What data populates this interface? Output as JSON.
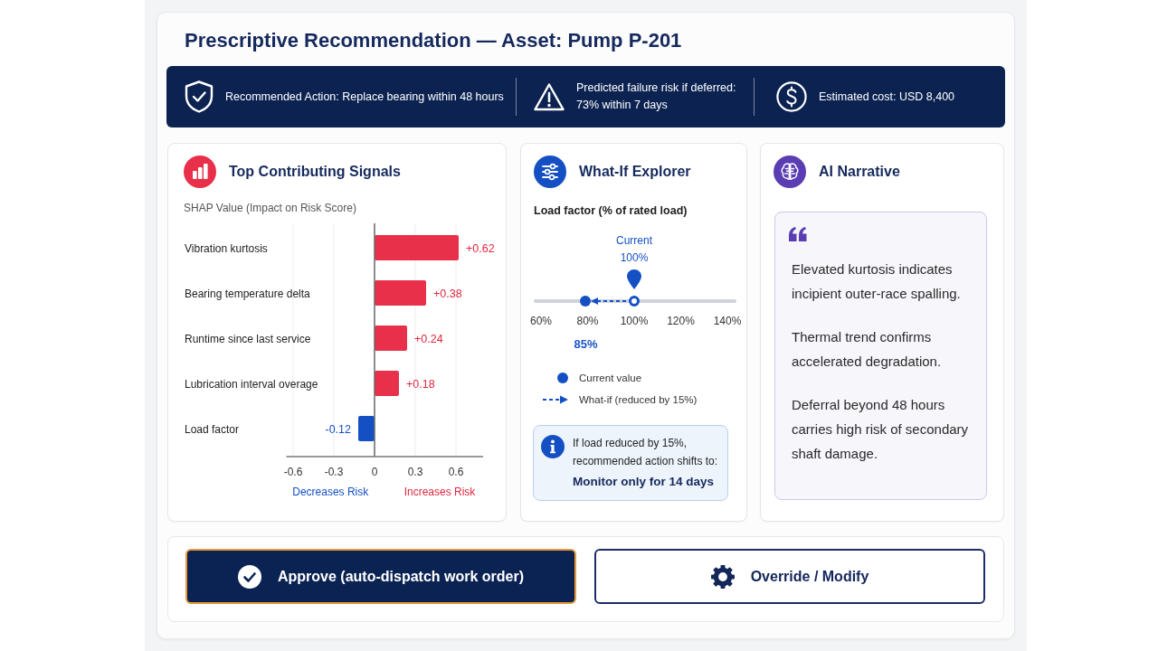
{
  "title": "Prescriptive Recommendation — Asset: Pump P-201",
  "summary_bar": [
    {
      "kind": "action",
      "text": "Recommended Action: Replace bearing within 48 hours"
    },
    {
      "kind": "risk",
      "text": "Predicted failure risk if deferred: 73% within 7 days"
    },
    {
      "kind": "cost",
      "text": "Estimated cost: USD 8,400"
    }
  ],
  "signals_panel": {
    "title": "Top Contributing Signals",
    "chart_data": {
      "type": "bar",
      "orientation": "horizontal",
      "title": "SHAP Value (Impact on Risk Score)",
      "categories": [
        "Vibration kurtosis",
        "Bearing temperature delta",
        "Runtime since last service",
        "Lubrication interval overage",
        "Load factor"
      ],
      "values": [
        0.62,
        0.38,
        0.24,
        0.18,
        -0.12
      ],
      "value_labels": [
        "+0.62",
        "+0.38",
        "+0.24",
        "+0.18",
        "-0.12"
      ],
      "xlim": [
        -0.65,
        0.8
      ],
      "xticks": [
        -0.6,
        -0.3,
        0,
        0.3,
        0.6
      ],
      "grid": true,
      "annotations": [
        "Decreases Risk",
        "Increases Risk"
      ]
    }
  },
  "whatif_panel": {
    "title": "What-If Explorer",
    "slider": {
      "label": "Load factor (% of rated load)",
      "ticks": [
        "60%",
        "80%",
        "100%",
        "120%",
        "140%"
      ],
      "current": {
        "caption": "Current",
        "value": "100%",
        "level": 0.5
      },
      "what_if": {
        "value": "85%",
        "level": 0.24
      }
    },
    "legend": [
      {
        "kind": "current",
        "label": "Current value"
      },
      {
        "kind": "what_if",
        "label": "What-if (reduced by 15%)"
      }
    ],
    "note": {
      "text": "If load reduced by 15%, recommended action shifts to:",
      "result": "Monitor only for 14 days"
    }
  },
  "narrative_panel": {
    "title": "AI Narrative",
    "paragraphs": [
      "Elevated kurtosis indicates incipient outer-race spalling.",
      "Thermal trend confirms accelerated degradation.",
      "Deferral beyond 48 hours carries high risk of secondary shaft damage."
    ]
  },
  "actions": [
    {
      "kind": "approve",
      "label": "Approve (auto-dispatch work order)",
      "focused": true
    },
    {
      "kind": "override",
      "label": "Override / Modify",
      "focused": false
    }
  ]
}
